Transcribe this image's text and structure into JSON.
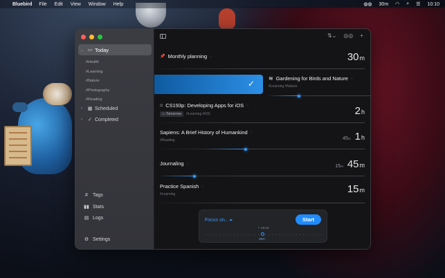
{
  "menubar": {
    "apple": "",
    "app": "Bluebird",
    "items": [
      "File",
      "Edit",
      "View",
      "Window",
      "Help"
    ],
    "timer": "30m",
    "clock": "10:10"
  },
  "sidebar": {
    "today": "Today",
    "tags": [
      "#Health",
      "#Learning",
      "#Nature",
      "#Photography",
      "#Reading"
    ],
    "scheduled": "Scheduled",
    "completed": "Completed",
    "bottom": {
      "tags": "Tags",
      "stats": "Stats",
      "logs": "Logs",
      "settings": "Settings"
    }
  },
  "tasks": [
    {
      "icon": "📌",
      "title": "Monthly planning",
      "tags": "",
      "duration": "30",
      "unit": "m"
    },
    {
      "icon": "≋",
      "title": "Gardening for Birds and Nature",
      "tags": "#Learning #Nature",
      "progress": 0.29
    },
    {
      "icon": "⌂",
      "title": "CS193p: Developing Apps for iOS",
      "chip": "Tomorrow",
      "tags": "#Learning #iOS",
      "duration": "2",
      "unit": "h"
    },
    {
      "title": "Sapiens: A Brief History of Humankind",
      "tags": "#Reading",
      "pre_val": "45",
      "pre_unit": "m",
      "duration": "1",
      "unit": "h",
      "progress": 0.42
    },
    {
      "title": "Journaling",
      "tags": "",
      "pre_val": "15",
      "pre_unit": "m",
      "duration": "45",
      "unit": "m",
      "progress": 0.17
    },
    {
      "title": "Practice Spanish",
      "tags": "#Learning",
      "duration": "15",
      "unit": "m"
    }
  ],
  "focus": {
    "label": "Focus on... ▸",
    "start": "Start",
    "time": "⚐ 10:10",
    "duration": "30m"
  },
  "colors": {
    "accent": "#3a9bff",
    "start": "#1f8cff"
  }
}
